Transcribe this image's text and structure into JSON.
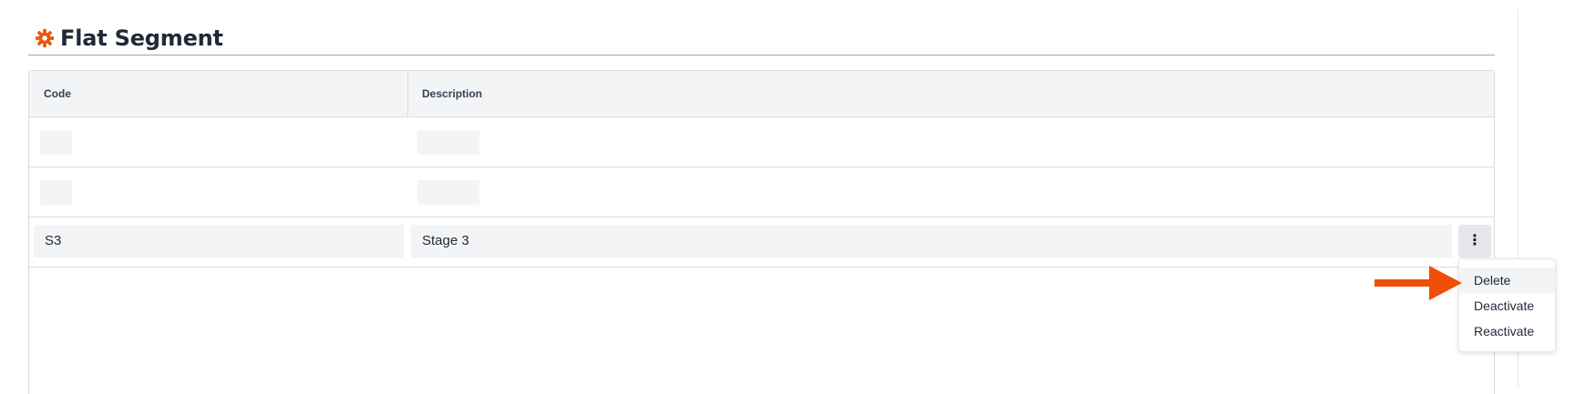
{
  "header": {
    "title": "Flat Segment",
    "icon": "gear-icon",
    "icon_color": "#ea580c"
  },
  "table": {
    "columns": [
      "Code",
      "Description"
    ],
    "rows": [
      {
        "code": "",
        "description": "",
        "loading": true
      },
      {
        "code": "",
        "description": "",
        "loading": true
      },
      {
        "code": "S3",
        "description": "Stage 3",
        "editable": true
      }
    ],
    "row_action_icon": "more-vertical-icon"
  },
  "context_menu": {
    "items": [
      "Delete",
      "Deactivate",
      "Reactivate"
    ],
    "highlighted": "Delete"
  },
  "annotation": {
    "type": "arrow",
    "color": "#f04e0b",
    "points_to": "Delete"
  }
}
